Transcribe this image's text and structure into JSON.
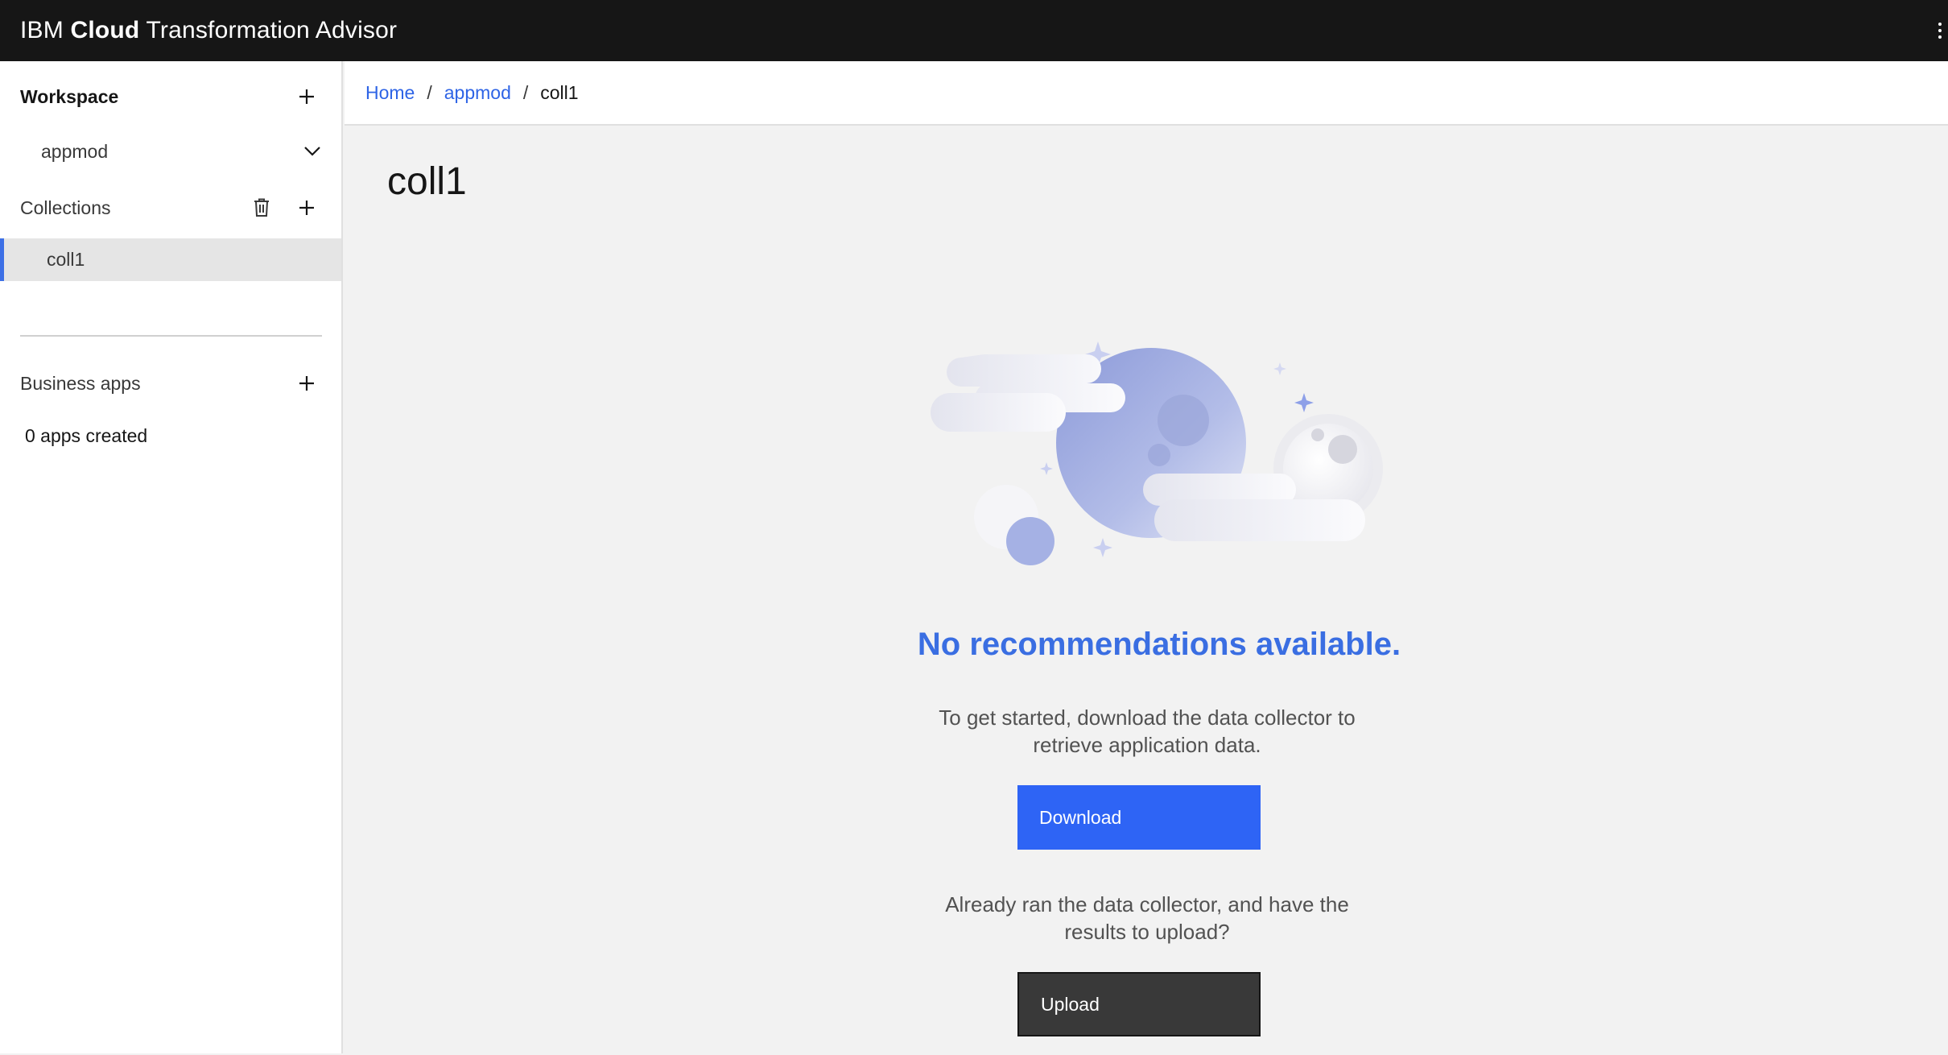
{
  "header": {
    "brand_prefix": "IBM",
    "brand_strong": "Cloud",
    "brand_suffix": "Transformation Advisor"
  },
  "sidebar": {
    "workspace_title": "Workspace",
    "workspace_selected": "appmod",
    "collections_title": "Collections",
    "collections": [
      {
        "label": "coll1",
        "active": true
      }
    ],
    "business_apps_title": "Business apps",
    "apps_count_text": "0 apps created"
  },
  "breadcrumb": {
    "home": "Home",
    "workspace": "appmod",
    "current": "coll1",
    "separator": "/"
  },
  "main": {
    "title": "coll1",
    "empty_title": "No recommendations available.",
    "empty_desc_1": "To get started, download the data collector to retrieve application data.",
    "download_label": "Download",
    "empty_desc_2": "Already ran the data collector, and have the results to upload?",
    "upload_label": "Upload"
  },
  "colors": {
    "header_bg": "#161616",
    "accent_blue": "#2e64f5",
    "link_blue": "#2e64e6",
    "active_indicator": "#3d70e6",
    "secondary_button": "#393939"
  },
  "icons": {
    "overflow": "overflow-menu-vertical-icon",
    "add": "plus-icon",
    "chevron": "chevron-down-icon",
    "delete": "trash-can-icon"
  }
}
